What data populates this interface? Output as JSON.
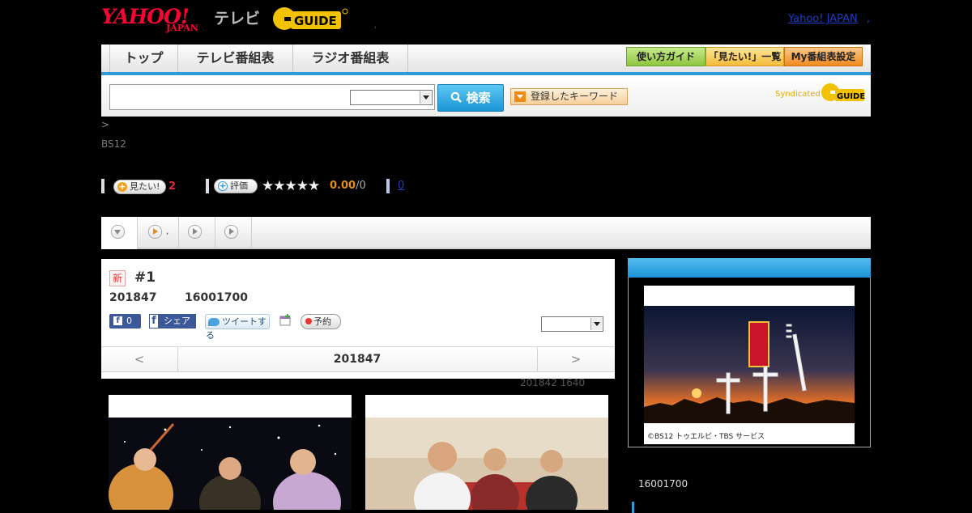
{
  "header": {
    "yahoo_logo": "YAHOO!",
    "yahoo_japan": "JAPAN",
    "tv_label": "テレビ",
    "gguide_logo": "GUIDE",
    "yahoo_japan_link": "Yahoo! JAPAN"
  },
  "nav": {
    "tabs": [
      "トップ",
      "テレビ番組表",
      "ラジオ番組表"
    ],
    "buttons": [
      "使い方ガイド",
      "「見たい!」一覧",
      "My番組表設定"
    ],
    "button_colors": [
      "#9bd04b",
      "#f8c64a",
      "#f39a2e"
    ]
  },
  "search": {
    "button_label": "検索",
    "keyword_button": "登録したキーワード",
    "syndicated_label": "Syndicated"
  },
  "breadcrumb": ">",
  "channel": "BS12",
  "stats": {
    "want_label": "見たい!",
    "want_count": "2",
    "rate_label": "評価",
    "stars": "★★★★★",
    "score": "0.00",
    "score_count": "/0",
    "link_count": "0"
  },
  "program": {
    "new_badge": "新",
    "title": "#1",
    "date": "201847",
    "time": "16001700",
    "facebook_count": "0",
    "share_label": "シェア",
    "tweet_label": "ツイートする",
    "reserve_label": "予約",
    "pager_prev": "<",
    "pager_center": "201847",
    "pager_next": ">",
    "updated": "201842  1640"
  },
  "side": {
    "image_caption": "©BS12 トゥエルビ・TBS サービス",
    "time": "16001700"
  },
  "colors": {
    "accent_blue": "#2e9ad6",
    "yahoo_red": "#ff0033",
    "gguide_yellow": "#f2c200"
  }
}
